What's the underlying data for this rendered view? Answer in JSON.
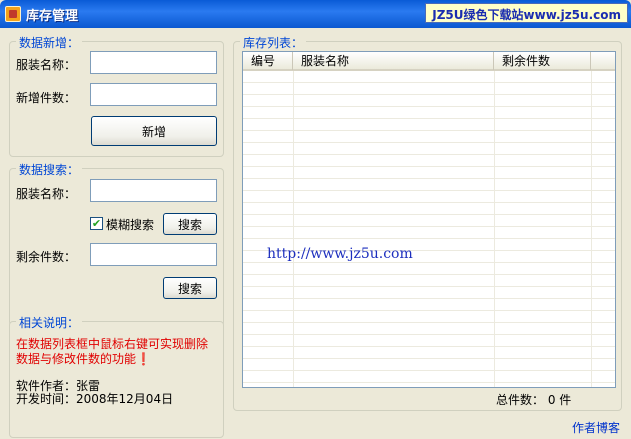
{
  "window": {
    "title": "库存管理",
    "banner": "JZ5U绿色下载站www.jz5u.com"
  },
  "add_section": {
    "title": "数据新增：",
    "name_label": "服装名称：",
    "name_value": "",
    "count_label": "新增件数：",
    "count_value": "",
    "add_button": "新增"
  },
  "search_section": {
    "title": "数据搜索：",
    "name_label": "服装名称：",
    "name_value": "",
    "fuzzy_label": "模糊搜索",
    "fuzzy_checked": true,
    "search_button_1": "搜索",
    "remain_label": "剩余件数：",
    "remain_value": "",
    "search_button_2": "搜索"
  },
  "info_section": {
    "title": "相关说明：",
    "description": "在数据列表框中鼠标右键可实现删除数据与修改件数的功能❗",
    "author": "软件作者：张雷",
    "dev_time": "开发时间：2008年12月04日"
  },
  "inventory": {
    "title": "库存列表：",
    "columns": [
      "编号",
      "服装名称",
      "剩余件数"
    ],
    "rows": [],
    "watermark": "http://www.jz5u.com",
    "total": "总件数： 0 件"
  },
  "footer": {
    "blog_link": "作者博客"
  }
}
